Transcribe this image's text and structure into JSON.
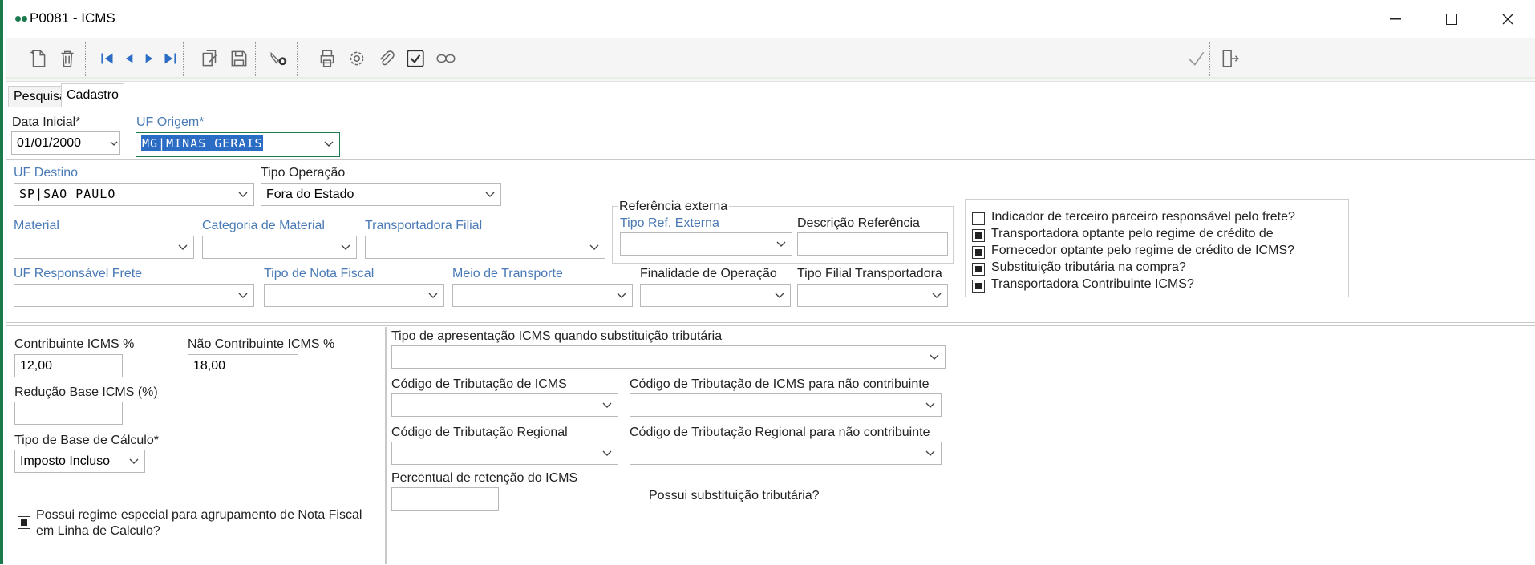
{
  "window": {
    "title": "P0081 - ICMS"
  },
  "tabs": [
    {
      "label": "Pesquisa"
    },
    {
      "label": "Cadastro"
    }
  ],
  "header": {
    "data_inicial": {
      "label": "Data Inicial*",
      "value": "01/01/2000"
    },
    "uf_origem": {
      "label": "UF Origem*",
      "value": "MG|MINAS GERAIS"
    }
  },
  "filters": {
    "uf_destino": {
      "label": "UF Destino",
      "value": "SP|SAO PAULO"
    },
    "tipo_operacao": {
      "label": "Tipo Operação",
      "value": "Fora do Estado"
    },
    "material": {
      "label": "Material",
      "value": ""
    },
    "categoria_material": {
      "label": "Categoria de Material",
      "value": ""
    },
    "transportadora_filial": {
      "label": "Transportadora Filial",
      "value": ""
    },
    "referencia_externa": {
      "label": "Referência externa"
    },
    "tipo_ref_externa": {
      "label": "Tipo Ref. Externa",
      "value": ""
    },
    "descricao_referencia": {
      "label": "Descrição Referência",
      "value": ""
    },
    "uf_responsavel_frete": {
      "label": "UF Responsável Frete",
      "value": ""
    },
    "tipo_nota_fiscal": {
      "label": "Tipo de Nota Fiscal",
      "value": ""
    },
    "meio_transporte": {
      "label": "Meio de Transporte",
      "value": ""
    },
    "finalidade_operacao": {
      "label": "Finalidade de Operação",
      "value": ""
    },
    "tipo_filial_transportadora": {
      "label": "Tipo Filial Transportadora",
      "value": ""
    }
  },
  "checks": [
    {
      "label": "Indicador de terceiro parceiro responsável pelo frete?",
      "checked": false
    },
    {
      "label": "Transportadora optante pelo regime de crédito de",
      "checked": true
    },
    {
      "label": "Fornecedor optante pelo regime de crédito de ICMS?",
      "checked": true
    },
    {
      "label": "Substituição tributária na compra?",
      "checked": true
    },
    {
      "label": "Transportadora Contribuinte ICMS?",
      "checked": true
    }
  ],
  "left": {
    "contribuinte": {
      "label": "Contribuinte ICMS %",
      "value": "12,00"
    },
    "nao_contribuinte": {
      "label": "Não Contribuinte ICMS %",
      "value": "18,00"
    },
    "reducao_base": {
      "label": "Redução Base ICMS (%)",
      "value": ""
    },
    "tipo_base": {
      "label": "Tipo de Base de Cálculo*",
      "value": "Imposto Incluso"
    },
    "regime_especial": {
      "line1": "Possui regime especial para agrupamento de Nota Fiscal",
      "line2": "em Linha de Calculo?",
      "checked": true
    }
  },
  "right": {
    "tipo_apresentacao": {
      "label": "Tipo de apresentação ICMS quando substituição tributária",
      "value": ""
    },
    "cod_trib_icms": {
      "label": "Código de Tributação de ICMS",
      "value": ""
    },
    "cod_trib_icms_nc": {
      "label": "Código de Tributação de ICMS para não contribuinte",
      "value": ""
    },
    "cod_trib_regional": {
      "label": "Código de Tributação Regional",
      "value": ""
    },
    "cod_trib_regional_nc": {
      "label": "Código de Tributação Regional para não contribuinte",
      "value": ""
    },
    "percentual_retencao": {
      "label": "Percentual de retenção do ICMS",
      "value": ""
    },
    "possui_st": {
      "label": "Possui substituição tributária?",
      "checked": false
    }
  },
  "colors": {
    "accent_green": "#1a7a4c",
    "label_blue": "#4a7ab5",
    "selection": "#2b6cc4"
  }
}
